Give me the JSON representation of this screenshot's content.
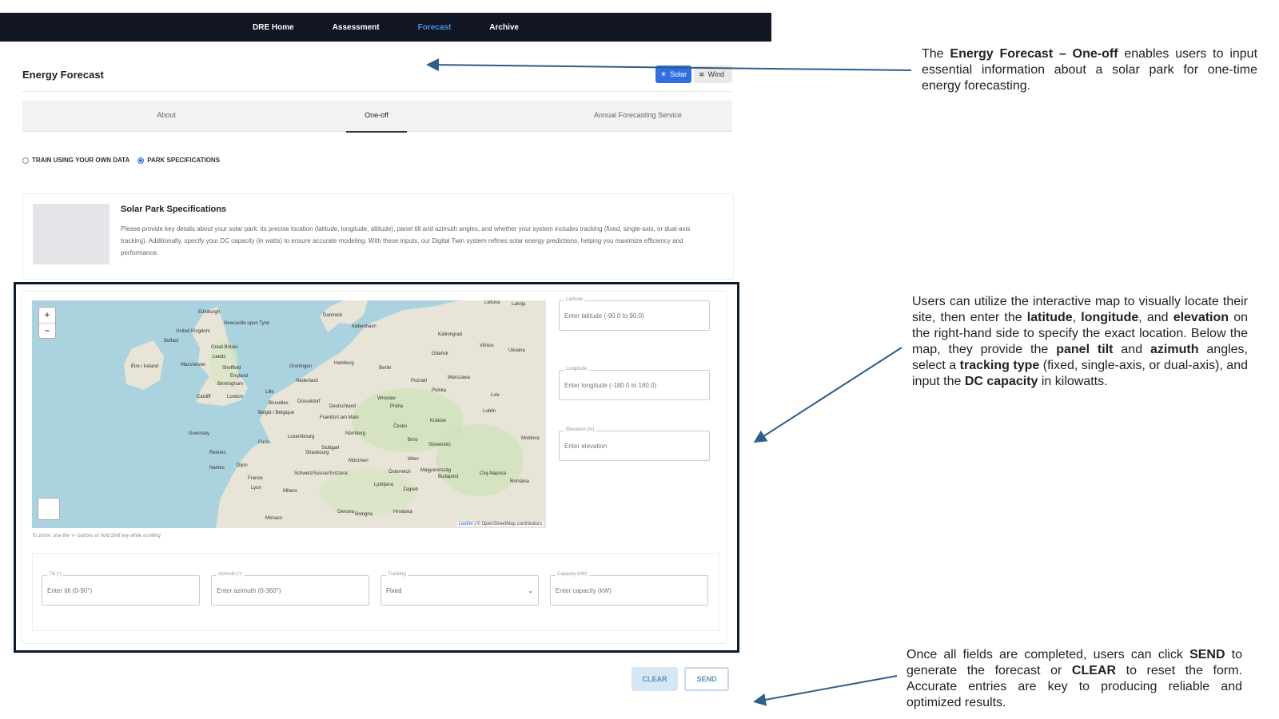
{
  "nav": {
    "items": [
      "DRE Home",
      "Assessment",
      "Forecast",
      "Archive"
    ],
    "active": "Forecast"
  },
  "page": {
    "title": "Energy Forecast"
  },
  "energy_toggle": {
    "solar": "Solar",
    "wind": "Wind"
  },
  "tabs": [
    "About",
    "One-off",
    "Annual Forecasting Service"
  ],
  "radio_options": {
    "train": "TRAIN USING YOUR OWN DATA",
    "park": "PARK SPECIFICATIONS",
    "selected": "PARK SPECIFICATIONS"
  },
  "spec_card": {
    "title": "Solar Park Specifications",
    "description": "Please provide key details about your solar park: its precise location (latitude, longitude, altitude), panel tilt and azimuth angles, and whether your system includes tracking (fixed, single-axis, or dual-axis tracking). Additionally, specify your DC capacity (in watts) to ensure accurate modeling. With these inputs, our Digital Twin system refines solar energy predictions, helping you maximize efficiency and performance."
  },
  "map": {
    "zoom_in": "+",
    "zoom_out": "−",
    "attribution_leaflet": "Leaflet",
    "attribution_rest": "| © OpenStreetMap contributors",
    "zoom_hint": "To zoom: Use the +/- buttons or hold Shift key while scrolling",
    "labels": [
      "Edinburgh",
      "United Kingdom",
      "Belfast",
      "Newcastle upon Tyne",
      "Great Britain",
      "Leeds",
      "Éire / Ireland",
      "Manchester",
      "Sheffield",
      "Birmingham",
      "England",
      "Cardiff",
      "London",
      "Guernsey",
      "Rennes",
      "Nantes",
      "Paris",
      "France",
      "Danmark",
      "København",
      "Hamburg",
      "Groningen",
      "Nederland",
      "Berlin",
      "Poznań",
      "Warszawa",
      "Polska",
      "Deutschland",
      "Düsseldorf",
      "België / Belgique",
      "Frankfurt am Main",
      "Luxembourg",
      "Praha",
      "Česko",
      "Nürnberg",
      "Stuttgart",
      "München",
      "Schweiz/Suisse/Svizzera",
      "Österreich",
      "Wien",
      "Slovensko",
      "Magyarország",
      "Budapest",
      "Ljubljana",
      "Hrvatska",
      "Milano",
      "Monaco",
      "Bologna",
      "Lietuva",
      "Vilnius",
      "Gdańsk",
      "Kraków",
      "Lviv",
      "Kaliningrad",
      "Dijon",
      "Lyon",
      "Genova",
      "Zagreb",
      "Brno",
      "Wrocław",
      "Lublin",
      "Latvija",
      "Bruxelles",
      "Lille",
      "Strasbourg",
      "Ukraina",
      "Moldova",
      "România",
      "Cluj-Napoca"
    ]
  },
  "location_fields": {
    "latitude": {
      "label": "Latitude",
      "placeholder": "Enter latitude (-90.0 to 90.0)"
    },
    "longitude": {
      "label": "Longitude",
      "placeholder": "Enter longitude (-180.0 to 180.0)"
    },
    "elevation": {
      "label": "Elevation (m)",
      "placeholder": "Enter elevation"
    }
  },
  "param_fields": {
    "tilt": {
      "label": "Tilt (°)",
      "placeholder": "Enter tilt (0-90°)"
    },
    "azimuth": {
      "label": "Azimuth (°)",
      "placeholder": "Enter azimuth (0-360°)"
    },
    "tracking": {
      "label": "Tracking",
      "value": "Fixed"
    },
    "capacity": {
      "label": "Capacity (kW)",
      "placeholder": "Enter capacity (kW)"
    }
  },
  "buttons": {
    "clear": "CLEAR",
    "send": "SEND"
  },
  "annotations": {
    "a1": [
      "The ",
      "Energy Forecast – One-off",
      " enables users to input essential information about a solar park for one-time energy forecasting."
    ],
    "a2": [
      "Users can utilize the interactive map to visually locate their site, then enter the ",
      "latitude",
      ", ",
      "longitude",
      ", and ",
      "elevation",
      " on the right-hand side to specify the exact location. Below the map, they provide the ",
      "panel tilt",
      " and ",
      "azimuth",
      " angles, select a ",
      "tracking type",
      " (fixed, single-axis, or dual-axis), and input the ",
      "DC capacity",
      " in kilowatts."
    ],
    "a3": [
      "Once all fields are completed, users can click ",
      "SEND",
      " to generate the forecast or ",
      "CLEAR",
      " to reset the form. Accurate entries are key to producing reliable and optimized results."
    ]
  },
  "colors": {
    "nav_bg": "#111622",
    "active": "#4a8ee6",
    "solar": "#2f6fe0",
    "frame": "#0d1a2a",
    "arrow": "#2e5f8a"
  }
}
